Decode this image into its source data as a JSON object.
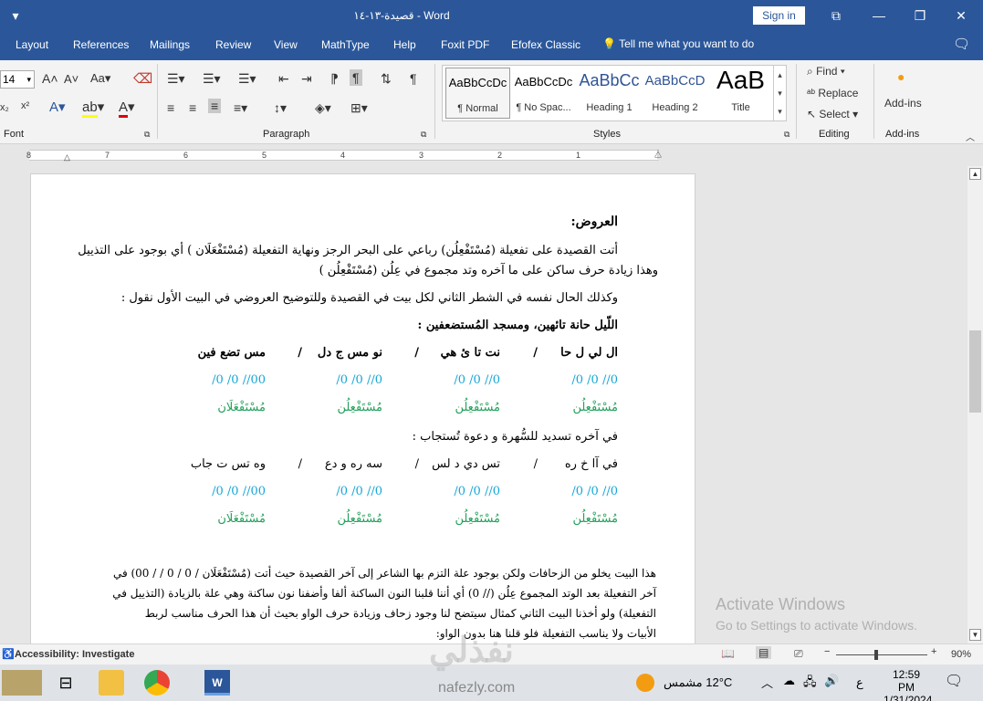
{
  "window": {
    "title": "قصيدة-١٣-١٤ - Word",
    "sign_in": "Sign in"
  },
  "tabs": [
    "Layout",
    "References",
    "Mailings",
    "Review",
    "View",
    "MathType",
    "Help",
    "Foxit PDF",
    "Efofex Classic"
  ],
  "tell_me": "Tell me what you want to do",
  "ribbon": {
    "font_size": "14",
    "groups": {
      "font": "Font",
      "paragraph": "Paragraph",
      "styles": "Styles",
      "editing": "Editing",
      "addins": "Add-ins"
    },
    "styles": [
      {
        "sample": "AaBbCcDc",
        "name": "¶ Normal"
      },
      {
        "sample": "AaBbCcDc",
        "name": "¶ No Spac..."
      },
      {
        "sample": "AaBbCc",
        "name": "Heading 1"
      },
      {
        "sample": "AaBbCcD",
        "name": "Heading 2"
      },
      {
        "sample": "AaB",
        "name": "Title"
      }
    ],
    "find": "Find",
    "replace": "Replace",
    "select": "Select",
    "addins_button": "Add-ins",
    "accent": "#2b579a"
  },
  "ruler_numbers": [
    "8",
    "7",
    "6",
    "5",
    "4",
    "3",
    "2",
    "1"
  ],
  "document": {
    "heading": "العروض:",
    "para1_line1": "أتت القصيدة على تفعيلة (مُسْتَفْعِلُن) رباعي على البحر الرجز ونهاية التفعيلة (مُسْتَفْعَلَان ) أي بوجود على التذييل",
    "para1_line2": "وهذا زيادة حرف ساكن على ما آخره وتد مجموع في عِلُن (مُسْتَفْعِلُن )",
    "para2": "وكذلك الحال نفسه في الشطر الثاني لكل بيت في القصيدة وللتوضيح العروضي في البيت الأول نقول :",
    "verse1": "اللّيل حانة تائهين، ومسجد المُستضعفين :",
    "verse1_syll": [
      "ال لي ل حا",
      "/",
      "نت تا ئ هي",
      "/",
      "نو مس ج دل",
      "/",
      "مس تضع فين"
    ],
    "verse1_marks": [
      "/0 /0 //0",
      "/0 /0 //0",
      "/0 /0 //0",
      "/0 /0 //00"
    ],
    "verse1_feet": [
      "مُسْتَفْعِلُن",
      "مُسْتَفْعِلُن",
      "مُسْتَفْعِلُن",
      "مُسْتَفْعَلَان"
    ],
    "verse2": "في آخره تسديد للسُّهرة و دعوة تُستجاب :",
    "verse2_syll": [
      "في آا خ ره",
      "/",
      "تس دي د لس",
      "/",
      "سه ره و دع",
      "/",
      "وه تس ت جاب"
    ],
    "verse2_marks": [
      "/0 /0 //0",
      "/0 /0 //0",
      "/0 /0 //0",
      "/0 /0 //00"
    ],
    "verse2_feet": [
      "مُسْتَفْعِلُن",
      "مُسْتَفْعِلُن",
      "مُسْتَفْعِلُن",
      "مُسْتَفْعَلَان"
    ],
    "para3_l1": "هذا البيت يخلو من الزحافات ولكن بوجود علة التزم بها الشاعر إلى آخر القصيدة حيث أتت (مُسْتَفْعَلَان / 0 / 0 / / 00) في",
    "para3_l2": "آخر التفعيلة بعد الوتد المجموع عِلُن (// 0) أي أننا قلبنا النون الساكنة ألفا وأضفنا نون ساكنة وهي علة بالزيادة (التذييل في",
    "para3_l3": "التفعيلة) ولو أخذنا البيت الثاني كمثال سيتضح لنا وجود زحاف وزيادة حرف الواو بحيث أن هذا الحرف مناسب لربط",
    "para3_l4": "الأبيات ولا يناسب التفعيلة فلو قلنا هنا بدون الواو:",
    "mark_color": "#17a7d6",
    "foot_color": "#22a05a"
  },
  "activate": {
    "line1": "Activate Windows",
    "line2": "Go to Settings to activate Windows."
  },
  "status": {
    "accessibility": "Accessibility: Investigate",
    "zoom": "90%"
  },
  "taskbar": {
    "weather": "12°C  مشمس",
    "time": "12:59 PM",
    "date": "1/31/2024",
    "lang": "ع"
  },
  "watermark": {
    "logo": "نفذلي",
    "site": "nafezly.com"
  }
}
